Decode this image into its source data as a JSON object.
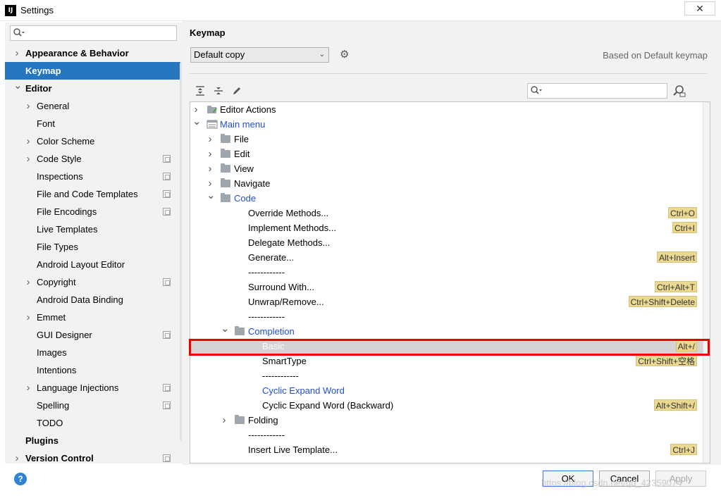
{
  "window": {
    "title": "Settings",
    "app_icon": "IJ",
    "close_glyph": "✕"
  },
  "sidebar": {
    "search": {
      "value": "",
      "placeholder": ""
    },
    "items": [
      {
        "label": "Appearance & Behavior",
        "bold": true,
        "arrow": "right",
        "indent": 0
      },
      {
        "label": "Keymap",
        "bold": true,
        "selected": true,
        "indent": 0
      },
      {
        "label": "Editor",
        "bold": true,
        "arrow": "down",
        "indent": 0
      },
      {
        "label": "General",
        "arrow": "right",
        "indent": 1
      },
      {
        "label": "Font",
        "indent": 1
      },
      {
        "label": "Color Scheme",
        "arrow": "right",
        "indent": 1
      },
      {
        "label": "Code Style",
        "arrow": "right",
        "indent": 1,
        "copy": true
      },
      {
        "label": "Inspections",
        "indent": 1,
        "copy": true
      },
      {
        "label": "File and Code Templates",
        "indent": 1,
        "copy": true
      },
      {
        "label": "File Encodings",
        "indent": 1,
        "copy": true
      },
      {
        "label": "Live Templates",
        "indent": 1
      },
      {
        "label": "File Types",
        "indent": 1
      },
      {
        "label": "Android Layout Editor",
        "indent": 1
      },
      {
        "label": "Copyright",
        "arrow": "right",
        "indent": 1,
        "copy": true
      },
      {
        "label": "Android Data Binding",
        "indent": 1
      },
      {
        "label": "Emmet",
        "arrow": "right",
        "indent": 1
      },
      {
        "label": "GUI Designer",
        "indent": 1,
        "copy": true
      },
      {
        "label": "Images",
        "indent": 1
      },
      {
        "label": "Intentions",
        "indent": 1
      },
      {
        "label": "Language Injections",
        "arrow": "right",
        "indent": 1,
        "copy": true
      },
      {
        "label": "Spelling",
        "indent": 1,
        "copy": true
      },
      {
        "label": "TODO",
        "indent": 1
      },
      {
        "label": "Plugins",
        "bold": true,
        "indent": 0
      },
      {
        "label": "Version Control",
        "bold": true,
        "arrow": "right",
        "indent": 0,
        "copy": true
      }
    ]
  },
  "main": {
    "title": "Keymap",
    "keymap_select": "Default copy",
    "based_on": "Based on Default keymap",
    "tree_search": {
      "value": ""
    },
    "tree": [
      {
        "label": "Editor Actions",
        "arrow": "right",
        "icon": "editor-actions",
        "level": 0
      },
      {
        "label": "Main menu",
        "arrow": "down",
        "icon": "main-menu",
        "level": 0,
        "blue": true
      },
      {
        "label": "File",
        "arrow": "right",
        "icon": "folder",
        "level": 1
      },
      {
        "label": "Edit",
        "arrow": "right",
        "icon": "folder",
        "level": 1
      },
      {
        "label": "View",
        "arrow": "right",
        "icon": "folder",
        "level": 1
      },
      {
        "label": "Navigate",
        "arrow": "right",
        "icon": "folder",
        "level": 1
      },
      {
        "label": "Code",
        "arrow": "down",
        "icon": "folder",
        "level": 1,
        "blue": true
      },
      {
        "label": "Override Methods...",
        "level": 2,
        "shortcut": "Ctrl+O"
      },
      {
        "label": "Implement Methods...",
        "level": 2,
        "shortcut": "Ctrl+I"
      },
      {
        "label": "Delegate Methods...",
        "level": 2
      },
      {
        "label": "Generate...",
        "level": 2,
        "shortcut": "Alt+Insert"
      },
      {
        "label": "------------",
        "level": 2
      },
      {
        "label": "Surround With...",
        "level": 2,
        "shortcut": "Ctrl+Alt+T"
      },
      {
        "label": "Unwrap/Remove...",
        "level": 2,
        "shortcut": "Ctrl+Shift+Delete"
      },
      {
        "label": "------------",
        "level": 2
      },
      {
        "label": "Completion",
        "arrow": "down",
        "icon": "folder",
        "level": 2,
        "blue": true
      },
      {
        "label": "Basic",
        "level": 3,
        "shortcut": "Alt+/",
        "selected": true
      },
      {
        "label": "SmartType",
        "level": 3,
        "shortcut": "Ctrl+Shift+空格"
      },
      {
        "label": "------------",
        "level": 3
      },
      {
        "label": "Cyclic Expand Word",
        "level": 3,
        "blue": true
      },
      {
        "label": "Cyclic Expand Word (Backward)",
        "level": 3,
        "shortcut": "Alt+Shift+/"
      },
      {
        "label": "Folding",
        "arrow": "right",
        "icon": "folder",
        "level": 2
      },
      {
        "label": "------------",
        "level": 2
      },
      {
        "label": "Insert Live Template...",
        "level": 2,
        "shortcut": "Ctrl+J"
      }
    ]
  },
  "footer": {
    "help": "?",
    "ok": "OK",
    "cancel": "Cancel",
    "apply": "Apply",
    "watermark": "https://blog.csdn.net/qq_42359074"
  },
  "colors": {
    "selection": "#2675bf",
    "shortcut_bg": "#ebd992",
    "link_blue": "#1f4fd1",
    "highlight": "#ee0000"
  }
}
